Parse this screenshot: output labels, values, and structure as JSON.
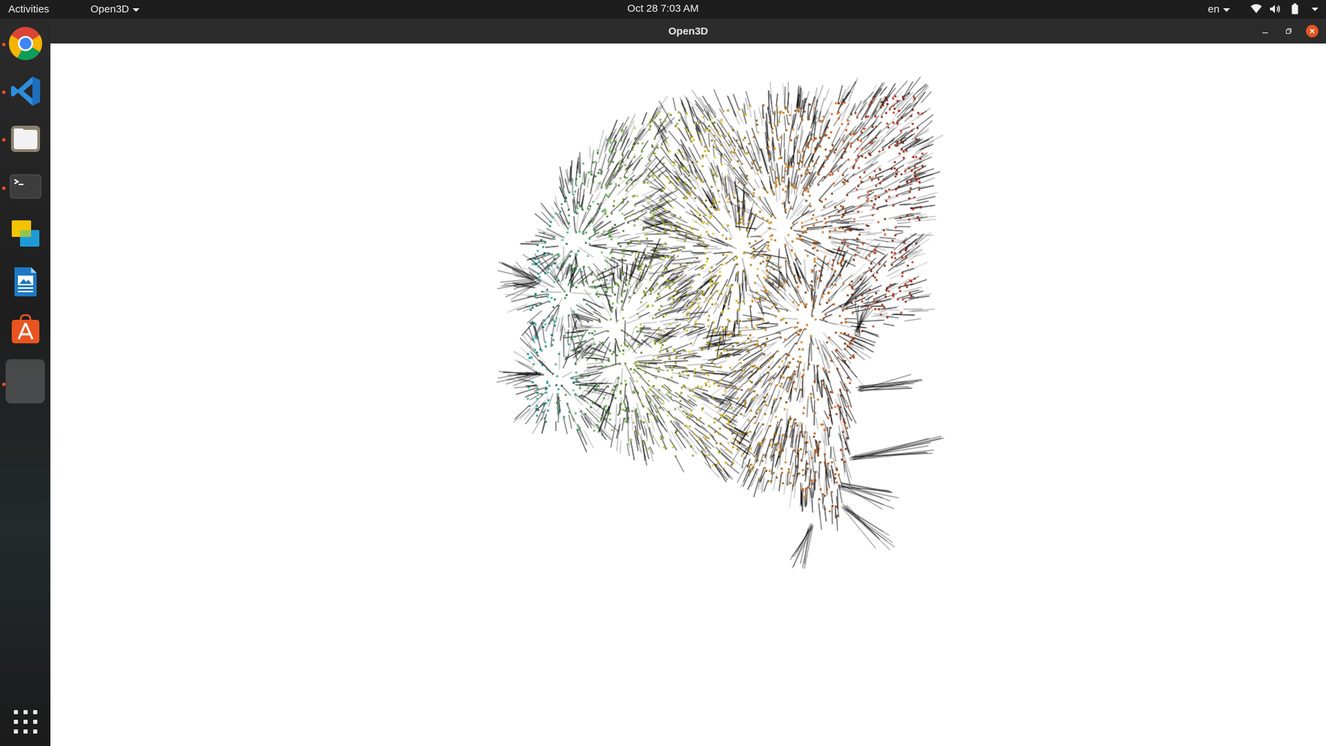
{
  "topbar": {
    "activities": "Activities",
    "app_menu": "Open3D",
    "clock": "Oct 28  7:03 AM",
    "language": "en",
    "icons": [
      "wifi-icon",
      "volume-icon",
      "battery-icon",
      "system-menu-chevron-icon"
    ]
  },
  "dock": {
    "items": [
      {
        "name": "chrome",
        "running": true
      },
      {
        "name": "vscode",
        "running": true
      },
      {
        "name": "files",
        "running": true
      },
      {
        "name": "terminal",
        "running": true
      },
      {
        "name": "slides",
        "running": false
      },
      {
        "name": "writer",
        "running": false
      },
      {
        "name": "software-center",
        "running": false
      },
      {
        "name": "open3d",
        "running": true,
        "active": true
      }
    ],
    "show_apps_icon": "grid-icon"
  },
  "window": {
    "title": "Open3D",
    "controls": [
      "minimize-icon",
      "maximize-icon",
      "close-icon"
    ]
  },
  "scene": {
    "type": "point-cloud-with-normals",
    "background": "#ffffff",
    "line_color": "#000000",
    "colormap": [
      "#1fb3b3",
      "#7fd05a",
      "#e8e02a",
      "#f0a020",
      "#e85818",
      "#d81a10"
    ]
  },
  "colors": {
    "accent": "#e95420",
    "topbar_bg": "#1d1d1d",
    "titlebar_bg": "#2c2c2c"
  }
}
